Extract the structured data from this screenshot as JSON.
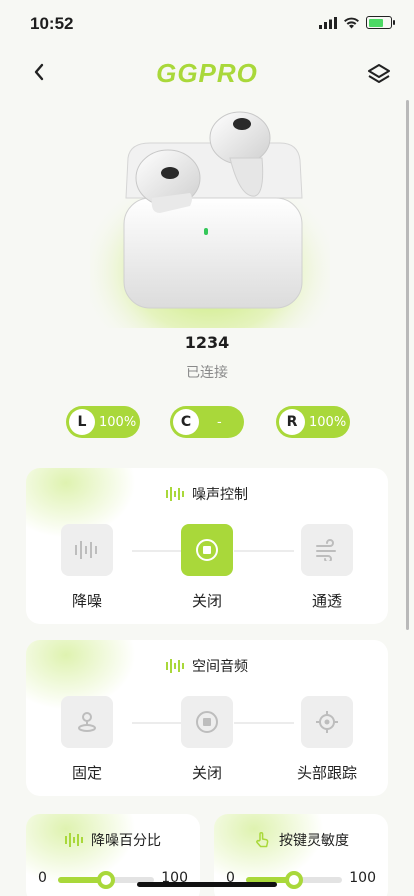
{
  "status": {
    "time": "10:52"
  },
  "nav": {
    "brand": "GGPRO"
  },
  "device": {
    "name": "1234",
    "status": "已连接"
  },
  "batteries": [
    {
      "letter": "L",
      "value": "100%"
    },
    {
      "letter": "C",
      "value": "-"
    },
    {
      "letter": "R",
      "value": "100%"
    }
  ],
  "anc": {
    "title": "噪声控制",
    "modes": [
      {
        "label": "降噪",
        "icon": "waveform-icon",
        "active": false
      },
      {
        "label": "关闭",
        "icon": "stop-icon",
        "active": true
      },
      {
        "label": "通透",
        "icon": "wind-icon",
        "active": false
      }
    ]
  },
  "spatial": {
    "title": "空间音频",
    "modes": [
      {
        "label": "固定",
        "icon": "joystick-icon",
        "active": false
      },
      {
        "label": "关闭",
        "icon": "stop-icon",
        "active": false
      },
      {
        "label": "头部跟踪",
        "icon": "target-icon",
        "active": false
      }
    ]
  },
  "anc_percent": {
    "title": "降噪百分比",
    "min": "0",
    "max": "100",
    "value": 50
  },
  "key_sensitivity": {
    "title": "按键灵敏度",
    "min": "0",
    "max": "100",
    "value": 50
  },
  "colors": {
    "accent": "#a9d83a",
    "background": "#f7f8f4"
  }
}
